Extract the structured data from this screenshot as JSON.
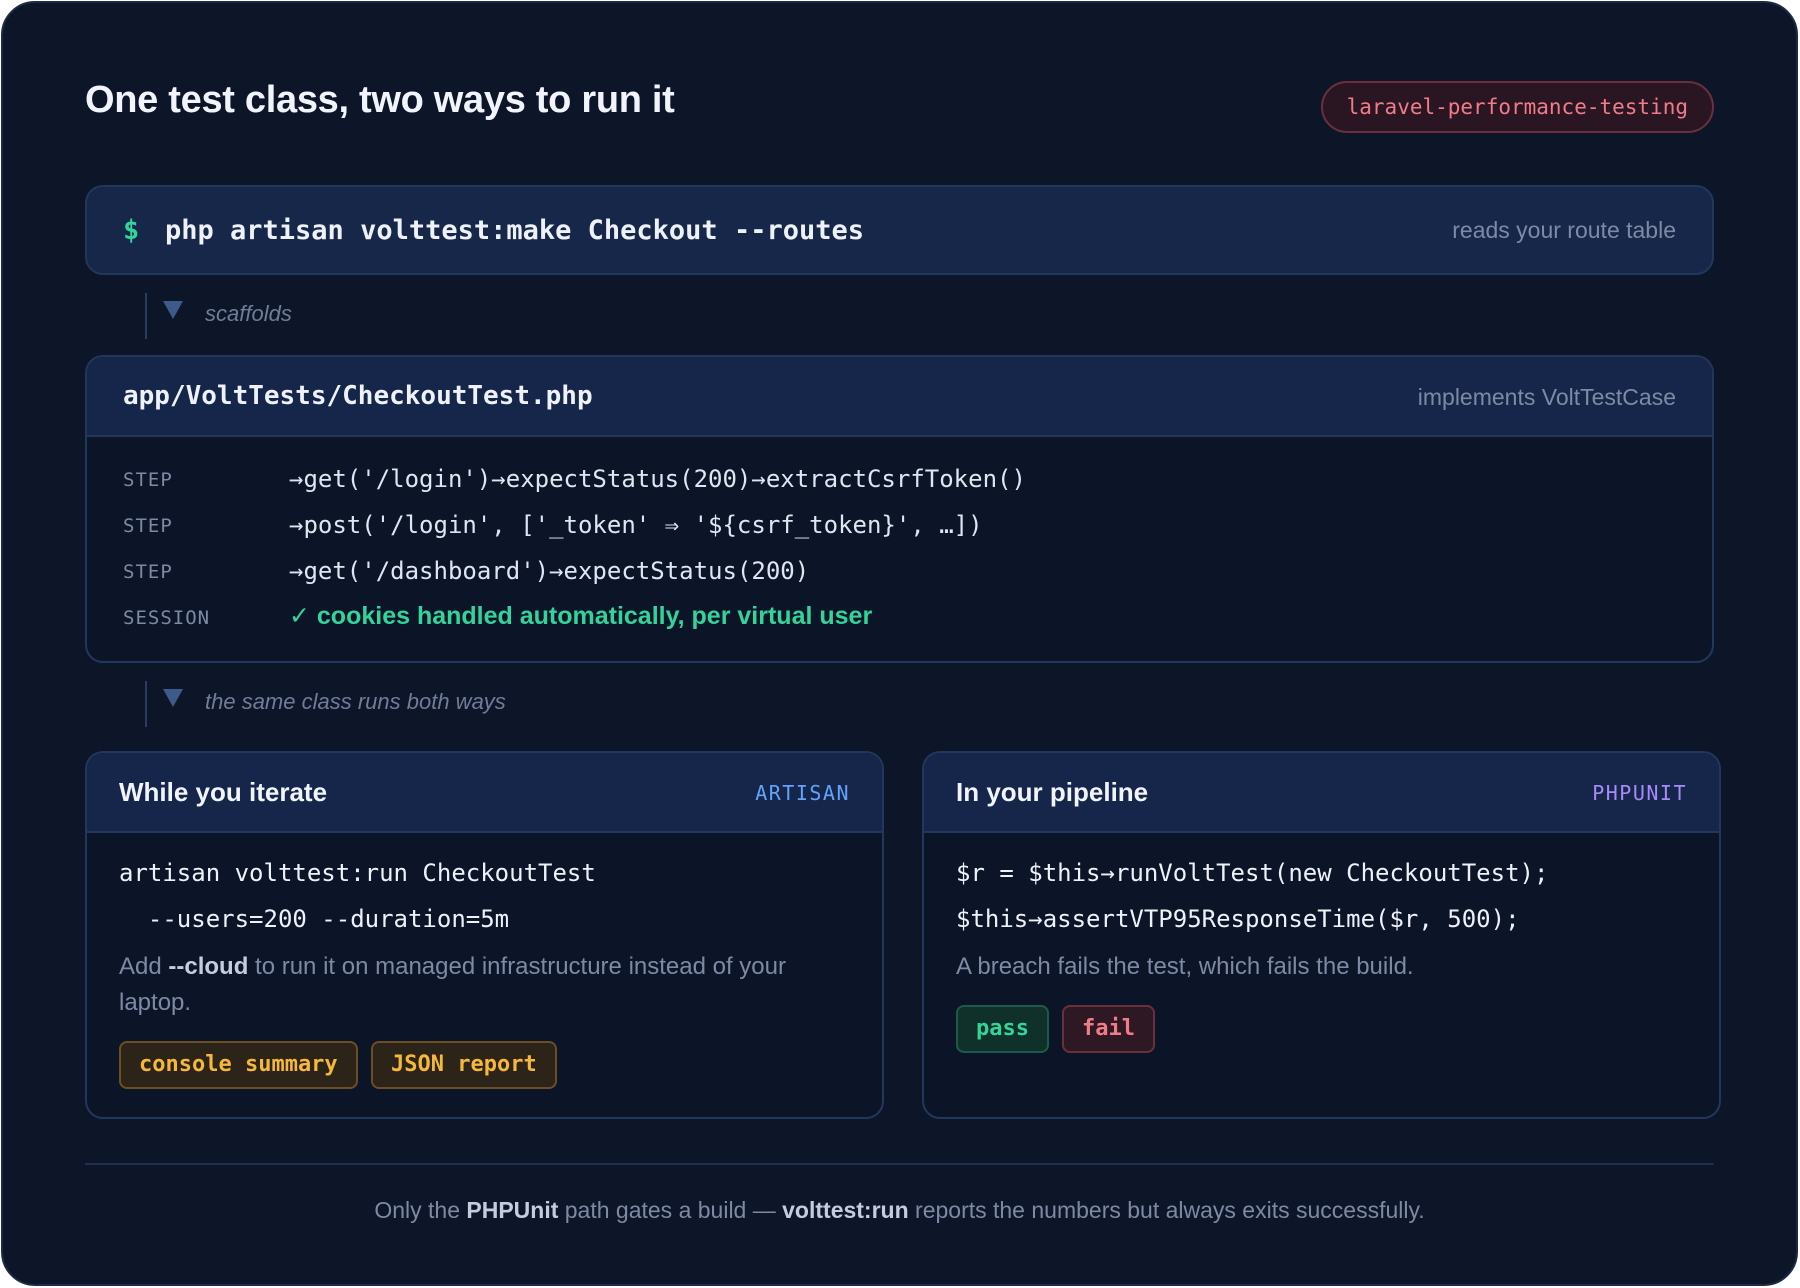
{
  "title": "One test class, two ways to run it",
  "badge": "laravel-performance-testing",
  "command": {
    "prompt": "$",
    "text": "php artisan volttest:make Checkout --routes",
    "note": "reads your route table"
  },
  "connectors": [
    {
      "label": "scaffolds"
    },
    {
      "label": "the same class runs both ways"
    }
  ],
  "file": {
    "path": "app/VoltTests/CheckoutTest.php",
    "note": "implements VoltTestCase",
    "steps": [
      {
        "kind": "STEP",
        "code": "→get('/login')→expectStatus(200)→extractCsrfToken()"
      },
      {
        "kind": "STEP",
        "code": "→post('/login', ['_token' ⇒ '${csrf_token}', …])"
      },
      {
        "kind": "STEP",
        "code": "→get('/dashboard')→expectStatus(200)"
      },
      {
        "kind": "SESSION",
        "code": "✓ cookies handled automatically, per virtual user"
      }
    ]
  },
  "modes": {
    "artisan": {
      "title": "While you iterate",
      "tag": "ARTISAN",
      "tag_color": "#60a5fa",
      "code_line1": "artisan volttest:run CheckoutTest",
      "code_line2": "  --users=200 --duration=5m",
      "desc_pre": "Add ",
      "desc_flag": "--cloud",
      "desc_post": " to run it on managed infrastructure instead of your laptop.",
      "chips": [
        "console summary",
        "JSON report"
      ]
    },
    "phpunit": {
      "title": "In your pipeline",
      "tag": "PHPUNIT",
      "tag_color": "#a78bfa",
      "code_line1": "$r = $this→runVoltTest(new CheckoutTest);",
      "code_line2": "$this→assertVTP95ResponseTime($r, 500);",
      "desc": "A breach fails the test, which fails the build.",
      "chips": [
        "pass",
        "fail"
      ]
    }
  },
  "footer": {
    "pre": "Only the ",
    "b1": "PHPUnit",
    "mid": " path gates a build — ",
    "b2": "volttest:run",
    "post": " reports the numbers but always exits successfully."
  },
  "colors": {
    "background": "#0d1628",
    "accent_green": "#34d399",
    "accent_red": "#f27b8a",
    "accent_amber": "#f5b73c"
  }
}
